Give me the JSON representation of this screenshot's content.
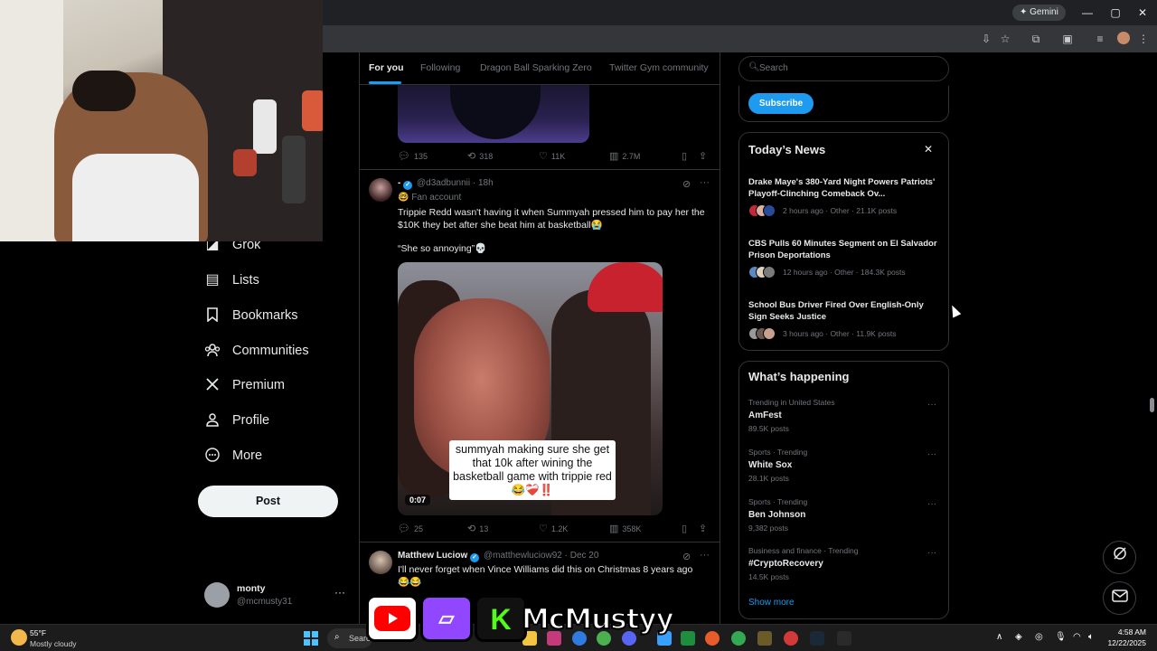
{
  "browser": {
    "gemini_label": "✦ Gemini",
    "minimize_glyph": "—",
    "maximize_glyph": "▢",
    "close_glyph": "✕",
    "icons": [
      "install-icon",
      "star-icon",
      "extensions-icon",
      "sidepanel-icon",
      "media-icon",
      "menu-icon"
    ]
  },
  "nav": {
    "items": [
      {
        "label": "Grok",
        "icon": "grok-icon",
        "glyph": "◪"
      },
      {
        "label": "Lists",
        "icon": "lists-icon",
        "glyph": "▤"
      },
      {
        "label": "Bookmarks",
        "icon": "bookmark-icon",
        "glyph": "🔖"
      },
      {
        "label": "Communities",
        "icon": "communities-icon",
        "glyph": "👥"
      },
      {
        "label": "Premium",
        "icon": "x-logo-icon",
        "glyph": "𝕏"
      },
      {
        "label": "Profile",
        "icon": "profile-icon",
        "glyph": "👤"
      },
      {
        "label": "More",
        "icon": "more-circle-icon",
        "glyph": "⊙"
      }
    ],
    "post_label": "Post",
    "account": {
      "name": "monty",
      "handle": "@mcmusty31",
      "more": "···"
    }
  },
  "tabs": [
    {
      "label": "For you",
      "active": true
    },
    {
      "label": "Following",
      "active": false
    },
    {
      "label": "Dragon Ball Sparking Zero",
      "active": false
    },
    {
      "label": "Twitter Gym community",
      "active": false
    }
  ],
  "prev_tweet": {
    "replies": "135",
    "reposts": "318",
    "likes": "11K",
    "views": "2.7M"
  },
  "tweet1": {
    "name": "-",
    "handle": "@d3adbunnii",
    "time": "· 18h",
    "badge": "🤓 Fan account",
    "text1": "Trippie Redd wasn't having it when Summyah pressed him to pay her the $10K they bet after she beat him at basketball😭",
    "text2": "“She so annoying”💀",
    "video_caption": "summyah making sure she get that 10k after wining the basketball game with trippie red 😂❤️‍🩹‼️",
    "video_time": "0:07",
    "replies": "25",
    "reposts": "13",
    "likes": "1.2K",
    "views": "358K"
  },
  "tweet2": {
    "name": "Matthew Luciow",
    "handle": "@matthewluciow92",
    "time": "· Dec 20",
    "text": "I'll never forget when Vince Williams did this on Christmas 8 years ago 😂😂"
  },
  "sidebar": {
    "search_placeholder": "Search",
    "subscribe_label": "Subscribe",
    "news_title": "Today’s News",
    "news": [
      {
        "title": "Drake Maye's 380-Yard Night Powers Patriots' Playoff-Clinching Comeback Ov...",
        "meta": "2 hours ago · Other · 21.1K posts"
      },
      {
        "title": "CBS Pulls 60 Minutes Segment on El Salvador Prison Deportations",
        "meta": "12 hours ago · Other · 184.3K posts"
      },
      {
        "title": "School Bus Driver Fired Over English-Only Sign Seeks Justice",
        "meta": "3 hours ago · Other · 11.9K posts"
      }
    ],
    "happening_title": "What’s happening",
    "trends": [
      {
        "context": "Trending in United States",
        "name": "AmFest",
        "count": "89.5K posts"
      },
      {
        "context": "Sports · Trending",
        "name": "White Sox",
        "count": "28.1K posts"
      },
      {
        "context": "Sports · Trending",
        "name": "Ben Johnson",
        "count": "9,382 posts"
      },
      {
        "context": "Business and finance · Trending",
        "name": "#CryptoRecovery",
        "count": "14.5K posts"
      }
    ],
    "show_more": "Show more"
  },
  "taskbar": {
    "temp": "55°F",
    "weather": "Mostly cloudy",
    "search_label": "Search",
    "time": "4:58 AM",
    "date": "12/22/2025"
  },
  "overlay": {
    "name": "McMustyy",
    "twitch_glyph": "▱",
    "kick_glyph": "K"
  },
  "colors": {
    "accent": "#1d9bf0",
    "background": "#000000",
    "border": "#2f3336",
    "muted": "#71767b"
  }
}
